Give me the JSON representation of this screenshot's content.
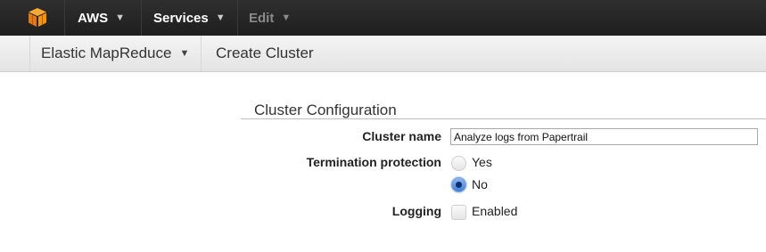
{
  "topbar": {
    "aws_label": "AWS",
    "services_label": "Services",
    "edit_label": "Edit",
    "chevron": "⌄",
    "logo_icon": "aws-cube-icon",
    "logo_color": "#f79500"
  },
  "subbar": {
    "service_name": "Elastic MapReduce",
    "page_title": "Create Cluster"
  },
  "form": {
    "section_title": "Cluster Configuration",
    "cluster_name_label": "Cluster name",
    "cluster_name_value": "Analyze logs from Papertrail",
    "termination_label": "Termination protection",
    "termination_options": [
      "Yes",
      "No"
    ],
    "termination_selected": "No",
    "logging_label": "Logging",
    "logging_option": "Enabled",
    "logging_checked": false
  }
}
